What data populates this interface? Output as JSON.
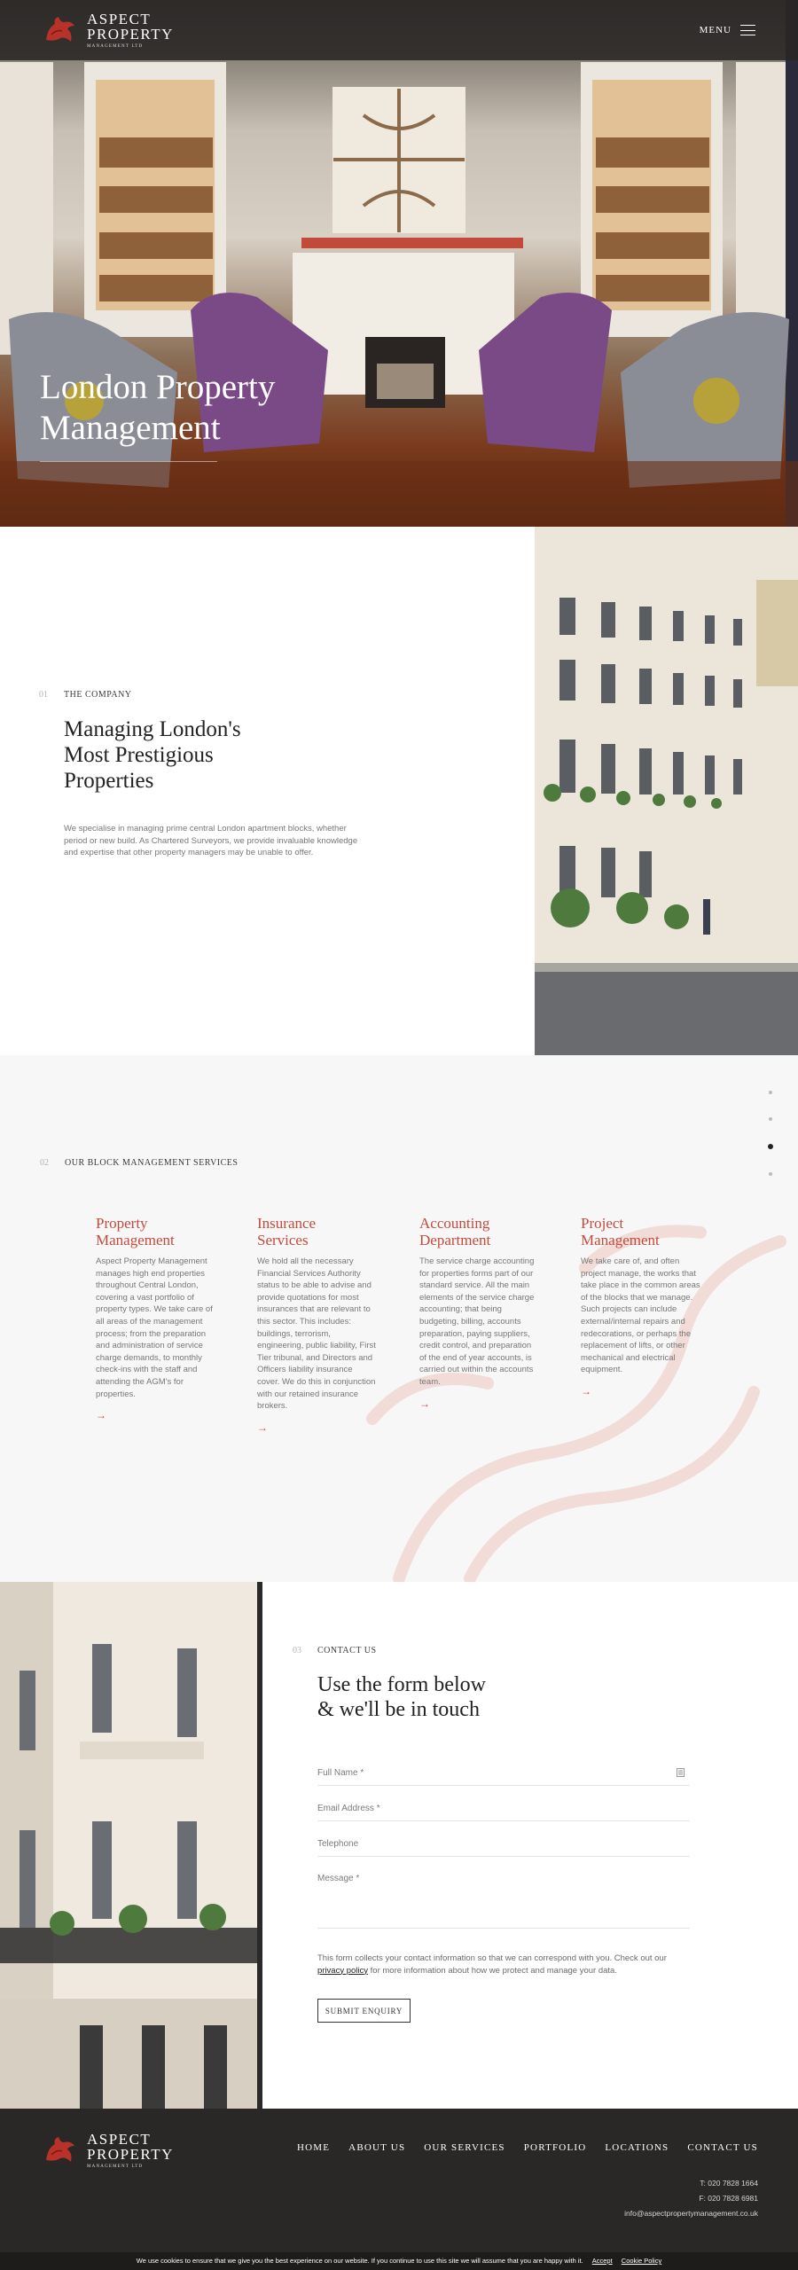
{
  "header": {
    "logo": {
      "line1": "ASPECT",
      "line2": "PROPERTY",
      "line3": "MANAGEMENT LTD"
    },
    "menu_label": "MENU"
  },
  "hero": {
    "title_line1": "London Property",
    "title_line2": "Management"
  },
  "company": {
    "number": "01",
    "label": "THE COMPANY",
    "heading_line1": "Managing London's",
    "heading_line2": "Most Prestigious",
    "heading_line3": "Properties",
    "text": "We specialise in managing prime central London apartment blocks, whether period or new build. As Chartered Surveyors, we provide invaluable knowledge and expertise that other property managers may be unable to offer."
  },
  "services": {
    "number": "02",
    "label": "OUR BLOCK MANAGEMENT SERVICES",
    "items": [
      {
        "title": "Property\nManagement",
        "text": "Aspect Property Management manages high end properties throughout Central London, covering a vast portfolio of property types. We take care of all areas of the management process; from the preparation and administration of service charge demands, to monthly check-ins with the staff and attending the AGM's for properties."
      },
      {
        "title": "Insurance\nServices",
        "text": "We hold all the necessary Financial Services Authority status to be able to advise and provide quotations for most insurances that are relevant to this sector. This includes: buildings, terrorism, engineering, public liability, First Tier tribunal, and Directors and Officers liability insurance cover. We do this in conjunction with our retained insurance brokers."
      },
      {
        "title": "Accounting\nDepartment",
        "text": "The service charge accounting for properties forms part of our standard service. All the main elements of the service charge accounting; that being budgeting, billing, accounts preparation, paying suppliers, credit control, and preparation of the end of year accounts, is carried out within the accounts team."
      },
      {
        "title": "Project\nManagement",
        "text": "We take care of, and often project manage, the works that take place in the common areas of the blocks that we manage. Such projects can include external/internal repairs and redecorations, or perhaps the replacement of lifts, or other mechanical and electrical equipment."
      }
    ],
    "arrow": "→"
  },
  "contact": {
    "number": "03",
    "label": "CONTACT US",
    "heading_line1": "Use the form below",
    "heading_line2": "& we'll be in touch",
    "fields": {
      "full_name": "Full Name *",
      "email": "Email Address *",
      "telephone": "Telephone",
      "message": "Message *"
    },
    "privacy_before": "This form collects your contact information so that we can correspond with you. Check out our",
    "privacy_link": "privacy policy",
    "privacy_after": "for more information about how we protect and manage your data.",
    "submit_label": "SUBMIT ENQUIRY"
  },
  "footer": {
    "nav": [
      "HOME",
      "ABOUT US",
      "OUR SERVICES",
      "PORTFOLIO",
      "LOCATIONS",
      "CONTACT US"
    ],
    "phone": "T: 020 7828 1664",
    "fax": "F: 020 7828 6981",
    "email": "info@aspectpropertymanagement.co.uk"
  },
  "cookie": {
    "text": "We use cookies to ensure that we give you the best experience on our website. If you continue to use this site we will assume that you are happy with it.",
    "accept": "Accept",
    "policy": "Cookie Policy"
  },
  "colors": {
    "accent": "#c44a3c",
    "dark": "#2a2827"
  }
}
